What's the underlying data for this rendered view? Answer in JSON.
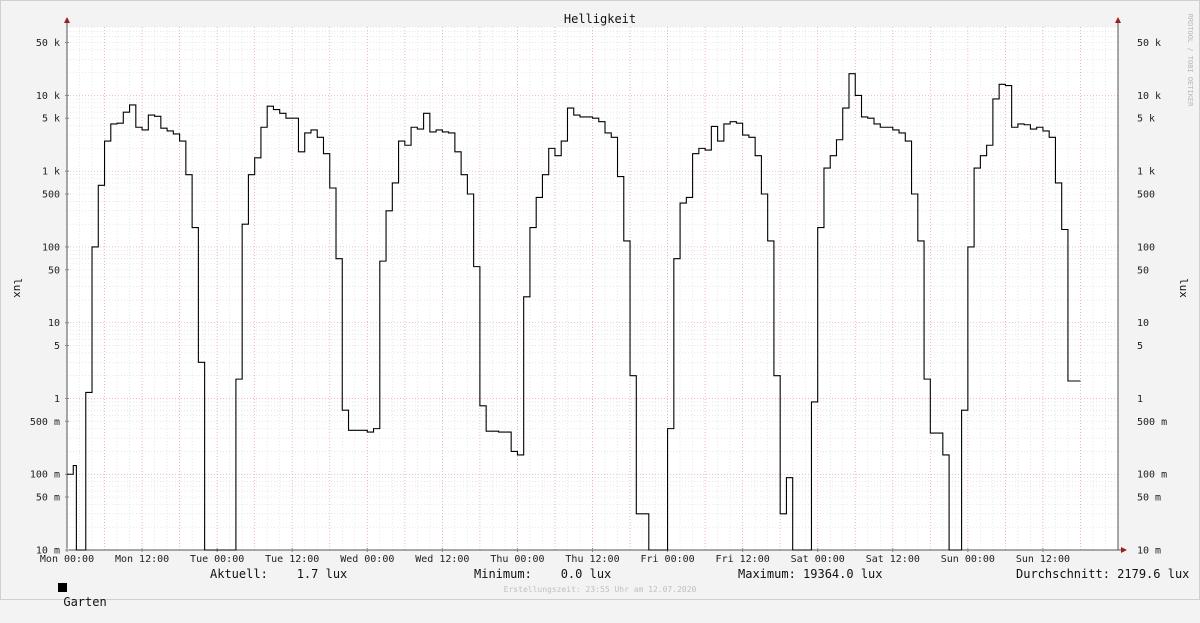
{
  "chart_data": {
    "type": "line",
    "title": "Helligkeit",
    "ylabel": "lux",
    "yscale": "log",
    "ylim": [
      0.01,
      80000
    ],
    "grid": true,
    "legend_placement": "bottom-left",
    "x_ticks": [
      "Mon 00:00",
      "Mon 12:00",
      "Tue 00:00",
      "Tue 12:00",
      "Wed 00:00",
      "Wed 12:00",
      "Thu 00:00",
      "Thu 12:00",
      "Fri 00:00",
      "Fri 12:00",
      "Sat 00:00",
      "Sat 12:00",
      "Sun 00:00",
      "Sun 12:00"
    ],
    "y_ticks": [
      {
        "value": 0.01,
        "label": "10 m"
      },
      {
        "value": 0.05,
        "label": "50 m"
      },
      {
        "value": 0.1,
        "label": "100 m"
      },
      {
        "value": 0.5,
        "label": "500 m"
      },
      {
        "value": 1,
        "label": "1"
      },
      {
        "value": 5,
        "label": "5"
      },
      {
        "value": 10,
        "label": "10"
      },
      {
        "value": 50,
        "label": "50"
      },
      {
        "value": 100,
        "label": "100"
      },
      {
        "value": 500,
        "label": "500"
      },
      {
        "value": 1000,
        "label": "1 k"
      },
      {
        "value": 5000,
        "label": "5 k"
      },
      {
        "value": 10000,
        "label": "10 k"
      },
      {
        "value": 50000,
        "label": "50 k"
      }
    ],
    "series": [
      {
        "name": "Garten",
        "color": "#000000",
        "x_hours": [
          0,
          1,
          1.5,
          2,
          3,
          4,
          5,
          6,
          7,
          8,
          9,
          10,
          11,
          12,
          13,
          14,
          15,
          16,
          17,
          18,
          19,
          20,
          21,
          22,
          23,
          24,
          27,
          28,
          29,
          30,
          31,
          32,
          33,
          34,
          35,
          36,
          37,
          38,
          39,
          40,
          41,
          42,
          43,
          44,
          45,
          46,
          47,
          48,
          49,
          50,
          51,
          52,
          53,
          54,
          55,
          56,
          57,
          58,
          59,
          60,
          61,
          62,
          63,
          64,
          65,
          66,
          67,
          68,
          69,
          70,
          71,
          72,
          73,
          74,
          75,
          76,
          77,
          78,
          79,
          80,
          81,
          82,
          83,
          84,
          85,
          86,
          87,
          88,
          89,
          90,
          91,
          92,
          93,
          94,
          95,
          96,
          97,
          98,
          99,
          100,
          101,
          102,
          103,
          104,
          105,
          106,
          107,
          108,
          109,
          110,
          111,
          112,
          113,
          114,
          115,
          116,
          117,
          118,
          119,
          120,
          121,
          122,
          123,
          124,
          125,
          126,
          127,
          128,
          129,
          130,
          131,
          132,
          133,
          134,
          135,
          136,
          137,
          138,
          139,
          140,
          141,
          142,
          143,
          144,
          145,
          146,
          147,
          148,
          149,
          150,
          151,
          152,
          153,
          154,
          155,
          156,
          157,
          158,
          159,
          160,
          161,
          162,
          163,
          164,
          165,
          166,
          167,
          167.5
        ],
        "values": [
          0.1,
          0.13,
          0.01,
          0.01,
          1.2,
          100,
          650,
          2500,
          4200,
          4300,
          6000,
          7500,
          3800,
          3500,
          5500,
          5300,
          3700,
          3400,
          3100,
          2500,
          900,
          180,
          3,
          0.01,
          0.01,
          0.01,
          1.8,
          200,
          900,
          1500,
          3800,
          7200,
          6500,
          5800,
          5000,
          5000,
          1800,
          3200,
          3500,
          2800,
          1700,
          600,
          70,
          0.7,
          0.38,
          0.38,
          0.38,
          0.36,
          0.4,
          65,
          300,
          700,
          2500,
          2200,
          3800,
          3600,
          5800,
          3300,
          3500,
          3300,
          3200,
          1800,
          900,
          500,
          55,
          0.8,
          0.37,
          0.37,
          0.36,
          0.36,
          0.2,
          0.18,
          22,
          180,
          450,
          900,
          2000,
          1600,
          2500,
          6800,
          5500,
          5200,
          5200,
          5000,
          4500,
          3200,
          2800,
          850,
          120,
          2,
          0.03,
          0.03,
          0.01,
          0.01,
          0.01,
          0.4,
          70,
          380,
          450,
          1700,
          2000,
          1900,
          3900,
          2500,
          4200,
          4500,
          4300,
          3000,
          2800,
          1600,
          500,
          120,
          2,
          0.03,
          0.09,
          0.01,
          0.01,
          0.01,
          0.9,
          180,
          1100,
          1600,
          2600,
          6800,
          19364,
          10000,
          5200,
          5000,
          4200,
          3800,
          3800,
          3500,
          3200,
          2500,
          500,
          120,
          1.8,
          0.35,
          0.35,
          0.18,
          0.01,
          0.01,
          0.7,
          100,
          1100,
          1600,
          2200,
          9000,
          14000,
          13500,
          3800,
          4200,
          4100,
          3600,
          3800,
          3400,
          2800,
          700,
          170,
          1.7,
          1.7
        ]
      }
    ]
  },
  "legend": {
    "series_label": "Garten",
    "current": "Aktuell:    1.7 lux",
    "minimum": "Minimum:    0.0 lux",
    "maximum": "Maximum: 19364.0 lux",
    "average": "Durchschnitt: 2179.6 lux"
  },
  "watermark": "RRDTOOL / TOBI OETIKER",
  "footer": "Erstellungszeit: 23:55 Uhr am 12.07.2020",
  "colors": {
    "background": "#f3f3f3",
    "plot_background": "#ffffff",
    "major_grid": "#f0a0a0",
    "minor_grid": "#d8d8d8",
    "line": "#000000",
    "axis_arrow": "#9a2020"
  }
}
